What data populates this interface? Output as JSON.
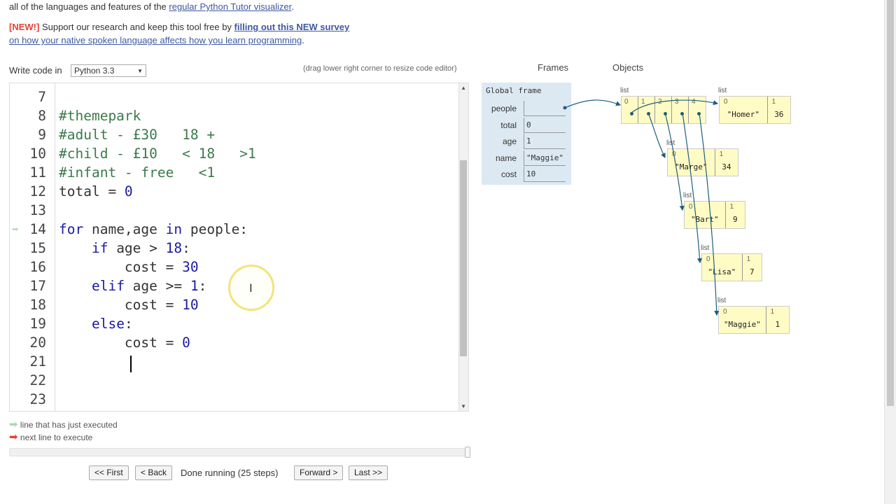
{
  "intro": {
    "line0_prefix": "all of the languages and features of the ",
    "line0_link": "regular Python Tutor visualizer",
    "line0_suffix": ".",
    "new_tag": "[NEW!]",
    "survey_prefix": " Support our research and keep this tool free by ",
    "survey_link": "filling out this NEW survey",
    "survey_line2_link": "on how your native spoken language affects how you learn programming",
    "survey_line2_suffix": "."
  },
  "editor_bar": {
    "write_label": "Write code in",
    "language": "Python 3.3",
    "resize_hint": "(drag lower right corner to resize code editor)"
  },
  "code": {
    "lines": [
      {
        "n": "7",
        "text": ""
      },
      {
        "n": "8",
        "text": "#themepark"
      },
      {
        "n": "9",
        "text": "#adult - £30   18 +"
      },
      {
        "n": "10",
        "text": "#child - £10   < 18   >1"
      },
      {
        "n": "11",
        "text": "#infant - free   <1"
      },
      {
        "n": "12",
        "text": "total = 0"
      },
      {
        "n": "13",
        "text": ""
      },
      {
        "n": "14",
        "text": "for name,age in people:"
      },
      {
        "n": "15",
        "text": "    if age > 18:"
      },
      {
        "n": "16",
        "text": "        cost = 30"
      },
      {
        "n": "17",
        "text": "    elif age >= 1:"
      },
      {
        "n": "18",
        "text": "        cost = 10"
      },
      {
        "n": "19",
        "text": "    else:"
      },
      {
        "n": "20",
        "text": "        cost = 0"
      },
      {
        "n": "21",
        "text": ""
      },
      {
        "n": "22",
        "text": ""
      },
      {
        "n": "23",
        "text": ""
      }
    ]
  },
  "legend": {
    "executed": "line that has just executed",
    "next": "next line to execute"
  },
  "controls": {
    "first": "<< First",
    "back": "< Back",
    "status": "Done running (25 steps)",
    "forward": "Forward >",
    "last": "Last >>"
  },
  "viz": {
    "frames_header": "Frames",
    "objects_header": "Objects",
    "global_frame": "Global frame",
    "vars": [
      {
        "name": "people",
        "value": ""
      },
      {
        "name": "total",
        "value": "0"
      },
      {
        "name": "age",
        "value": "1"
      },
      {
        "name": "name",
        "value": "\"Maggie\""
      },
      {
        "name": "cost",
        "value": "10"
      }
    ],
    "list_label": "list",
    "outer_indices": [
      "0",
      "1",
      "2",
      "3",
      "4"
    ],
    "tuples": [
      {
        "name": "\"Homer\"",
        "age": "36"
      },
      {
        "name": "\"Marge\"",
        "age": "34"
      },
      {
        "name": "\"Bart\"",
        "age": "9"
      },
      {
        "name": "\"Lisa\"",
        "age": "7"
      },
      {
        "name": "\"Maggie\"",
        "age": "1"
      }
    ],
    "tuple_indices": [
      "0",
      "1"
    ]
  },
  "colors": {
    "link": "#3d58a2",
    "new_tag": "#e93f34",
    "keyword": "#1a1aa6",
    "comment": "#3a7a4a",
    "frame_bg": "#dce9f2",
    "object_bg": "#fffbc4",
    "pointer": "#1f5f7a"
  }
}
